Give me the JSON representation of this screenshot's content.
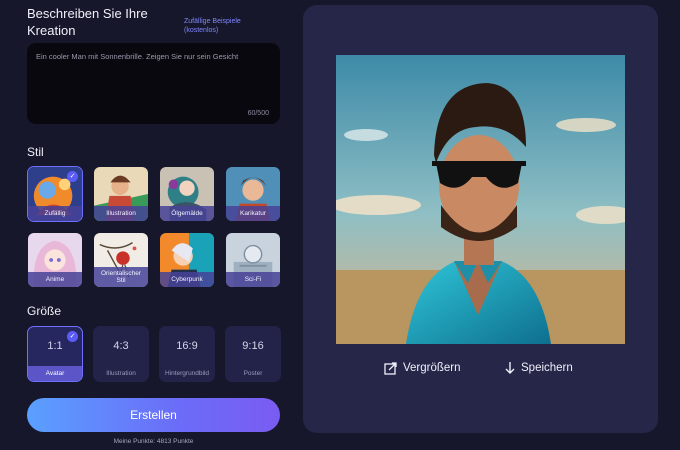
{
  "prompt": {
    "heading": "Beschreiben Sie Ihre Kreation",
    "random_examples": "Zufällige Beispiele (kostenlos)",
    "text": "Ein cooler Man mit Sonnenbrille. Zeigen Sie nur sein Gesicht",
    "char_count": "60/500"
  },
  "style": {
    "heading": "Stil",
    "items": [
      {
        "label": "Zufällig",
        "selected": true
      },
      {
        "label": "Illustration",
        "selected": false
      },
      {
        "label": "Ölgemälde",
        "selected": false
      },
      {
        "label": "Karikatur",
        "selected": false
      },
      {
        "label": "Anime",
        "selected": false
      },
      {
        "label": "Orientalischer Stil",
        "selected": false
      },
      {
        "label": "Cyberpunk",
        "selected": false
      },
      {
        "label": "Sci-Fi",
        "selected": false
      }
    ]
  },
  "size": {
    "heading": "Größe",
    "items": [
      {
        "ratio": "1:1",
        "label": "Avatar",
        "selected": true
      },
      {
        "ratio": "4:3",
        "label": "Illustration",
        "selected": false
      },
      {
        "ratio": "16:9",
        "label": "Hintergrundbild",
        "selected": false
      },
      {
        "ratio": "9:16",
        "label": "Poster",
        "selected": false
      }
    ]
  },
  "create_button": "Erstellen",
  "points": "Meine Punkte: 4813 Punkte",
  "preview": {
    "enlarge_label": "Vergrößern",
    "save_label": "Speichern"
  },
  "colors": {
    "background": "#17172b",
    "panel": "#262648",
    "accent": "#6f70ff",
    "button_gradient_start": "#5aa0ff",
    "button_gradient_end": "#7a5cf2"
  },
  "icons": {
    "check": "check-icon",
    "enlarge": "enlarge-icon",
    "download": "download-icon"
  }
}
